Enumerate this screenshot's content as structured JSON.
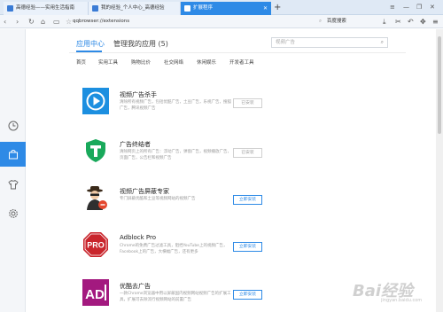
{
  "browser": {
    "tabs": [
      {
        "label": "高德经验——实用生活指南",
        "active": false
      },
      {
        "label": "我的经验_个人中心_高德经验",
        "active": false
      },
      {
        "label": "扩展程序",
        "active": true
      }
    ],
    "address": "qqbrowser://extensions",
    "search_engine_label": "百度搜索"
  },
  "sidebar": {
    "items": [
      {
        "icon": "clock-icon",
        "active": false
      },
      {
        "icon": "bag-icon",
        "active": true
      },
      {
        "icon": "shirt-icon",
        "active": false
      },
      {
        "icon": "gear-icon",
        "active": false
      }
    ]
  },
  "header": {
    "tab_center": "应用中心",
    "tab_manage": "管理我的应用",
    "manage_count": "(5)",
    "search_placeholder": "视频广告"
  },
  "categories": [
    "首页",
    "实用工具",
    "购物比价",
    "社交网络",
    "休闲娱乐",
    "开发者工具"
  ],
  "extensions": [
    {
      "name": "视频广告杀手",
      "desc": "清除所有视频广告，包括优酷广告，土豆广告，乐视广告，搜狐广告，腾讯视频广告",
      "button": "已安装",
      "installed": true
    },
    {
      "name": "广告终结者",
      "desc": "清除网页上的所有广告：浮动广告，弹窗广告，视频播放广告，页面广告，公告栏和视频广告",
      "button": "已安装",
      "installed": true
    },
    {
      "name": "视频广告屏蔽专家",
      "desc": "专门屏蔽优酷和土豆等视频网站的视频广告",
      "button": "立即安装",
      "installed": false
    },
    {
      "name": "Adblock Pro",
      "desc": "Chrome的免费广告过滤工具，阻挡YouTube上的视频广告，Facebook上的广告，大横幅广告，还有更多",
      "button": "立即安装",
      "installed": false
    },
    {
      "name": "优酷去广告",
      "desc": "一款Chrome浏览器中用以屏蔽国内视频网站视频广告的扩展工具，扩展可去除流行视频网站的前置广告",
      "button": "立即安装",
      "installed": false
    }
  ],
  "colors": {
    "accent": "#2e8ae6",
    "sidebar_active": "#2e8ae6"
  },
  "watermark": {
    "text": "Bai",
    "text2": "经验",
    "sub": "jingyan.baidu.com"
  }
}
